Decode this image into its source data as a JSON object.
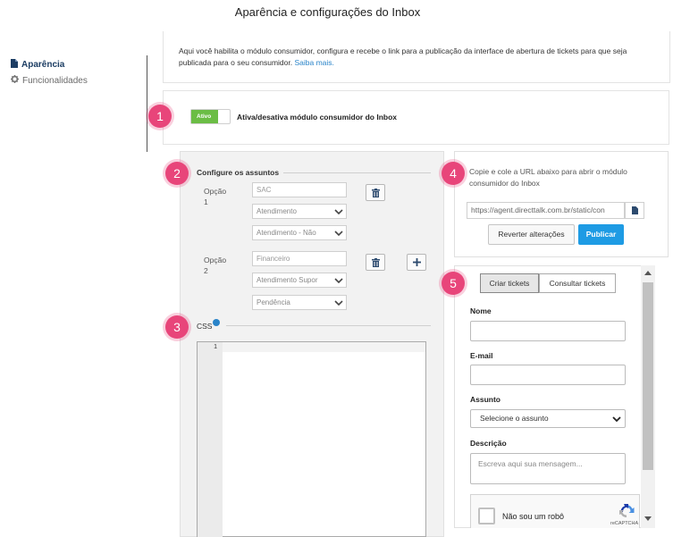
{
  "page": {
    "title": "Aparência e configurações do Inbox"
  },
  "sidebar": {
    "items": [
      {
        "label": "Aparência",
        "icon": "document-icon",
        "active": true
      },
      {
        "label": "Funcionalidades",
        "icon": "gear-icon",
        "active": false
      }
    ]
  },
  "info": {
    "text": "Aqui você habilita o módulo consumidor, configura e recebe o link para a publicação da interface de abertura de tickets para que seja publicada para o seu consumidor.",
    "link": "Saiba mais."
  },
  "badges": [
    "1",
    "2",
    "3",
    "4",
    "5"
  ],
  "module_toggle": {
    "state_label": "Ativo",
    "label": "Ativa/desativa módulo consumidor do Inbox"
  },
  "subjects": {
    "title": "Configure os assuntos",
    "options": [
      {
        "label": "Opção 1",
        "input_placeholder": "SAC",
        "selects": [
          "Atendimento",
          "Atendimento - Não"
        ]
      },
      {
        "label": "Opção 2",
        "input_placeholder": "Financeiro",
        "selects": [
          "Atendimento Supor",
          "Pendência"
        ]
      }
    ]
  },
  "css": {
    "title": "CSS",
    "line_number": "1"
  },
  "publish": {
    "description": "Copie e cole a URL abaixo para abrir o módulo consumidor do Inbox",
    "url": "https://agent.directtalk.com.br/static/con",
    "revert_label": "Reverter alterações",
    "publish_label": "Publicar"
  },
  "preview": {
    "tabs": [
      "Criar tickets",
      "Consultar tickets"
    ],
    "fields": {
      "name_label": "Nome",
      "email_label": "E-mail",
      "subject_label": "Assunto",
      "subject_value": "Selecione o assunto",
      "description_label": "Descrição",
      "description_placeholder": "Escreva aqui sua mensagem..."
    },
    "captcha": {
      "label": "Não sou um robô",
      "brand": "reCAPTCHA"
    }
  },
  "colors": {
    "accent": "#1e9be4",
    "badge": "#e8457a",
    "toggle_on": "#6bbd45",
    "nav_active": "#1c3d63"
  }
}
